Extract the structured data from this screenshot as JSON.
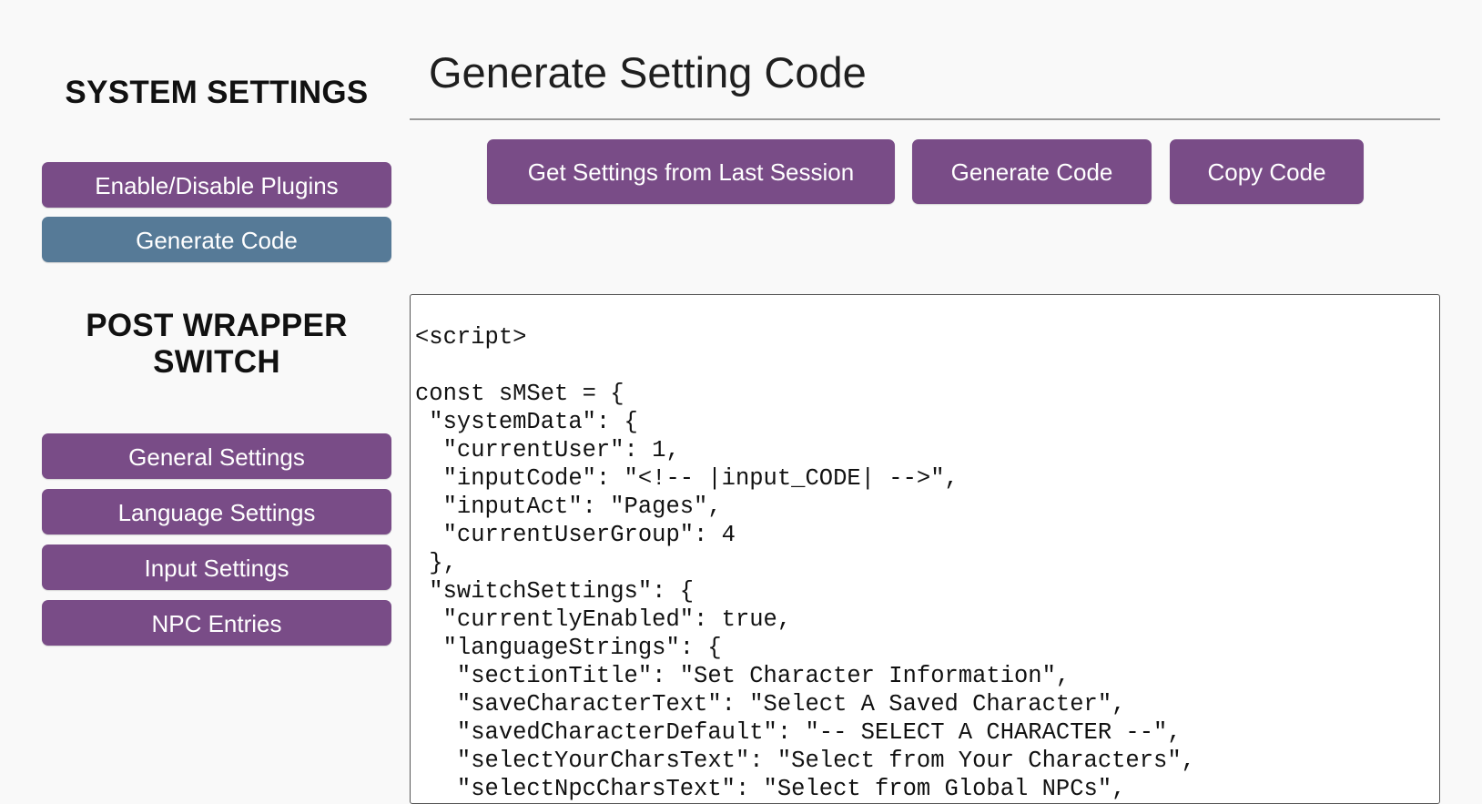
{
  "sidebar": {
    "system_heading": "SYSTEM SETTINGS",
    "system_items": [
      {
        "label": "Enable/Disable Plugins",
        "active": false
      },
      {
        "label": "Generate Code",
        "active": true
      }
    ],
    "post_heading_line1": "POST WRAPPER",
    "post_heading_line2": "SWITCH",
    "post_items": [
      {
        "label": "General Settings"
      },
      {
        "label": "Language Settings"
      },
      {
        "label": "Input Settings"
      },
      {
        "label": "NPC Entries"
      }
    ]
  },
  "main": {
    "title": "Generate Setting Code",
    "buttons": {
      "get_settings": "Get Settings from Last Session",
      "generate": "Generate Code",
      "copy": "Copy Code"
    },
    "code_lines": [
      "",
      "<script>",
      "",
      "const sMSet = {",
      " \"systemData\": {",
      "  \"currentUser\": 1,",
      "  \"inputCode\": \"<!-- |input_CODE| -->\",",
      "  \"inputAct\": \"Pages\",",
      "  \"currentUserGroup\": 4",
      " },",
      " \"switchSettings\": {",
      "  \"currentlyEnabled\": true,",
      "  \"languageStrings\": {",
      "   \"sectionTitle\": \"Set Character Information\",",
      "   \"saveCharacterText\": \"Select A Saved Character\",",
      "   \"savedCharacterDefault\": \"-- SELECT A CHARACTER --\",",
      "   \"selectYourCharsText\": \"Select from Your Characters\",",
      "   \"selectNpcCharsText\": \"Select from Global NPCs\","
    ]
  },
  "colors": {
    "button_purple": "#794c87",
    "button_active_blue": "#567a97",
    "background": "#f9f9f9"
  }
}
